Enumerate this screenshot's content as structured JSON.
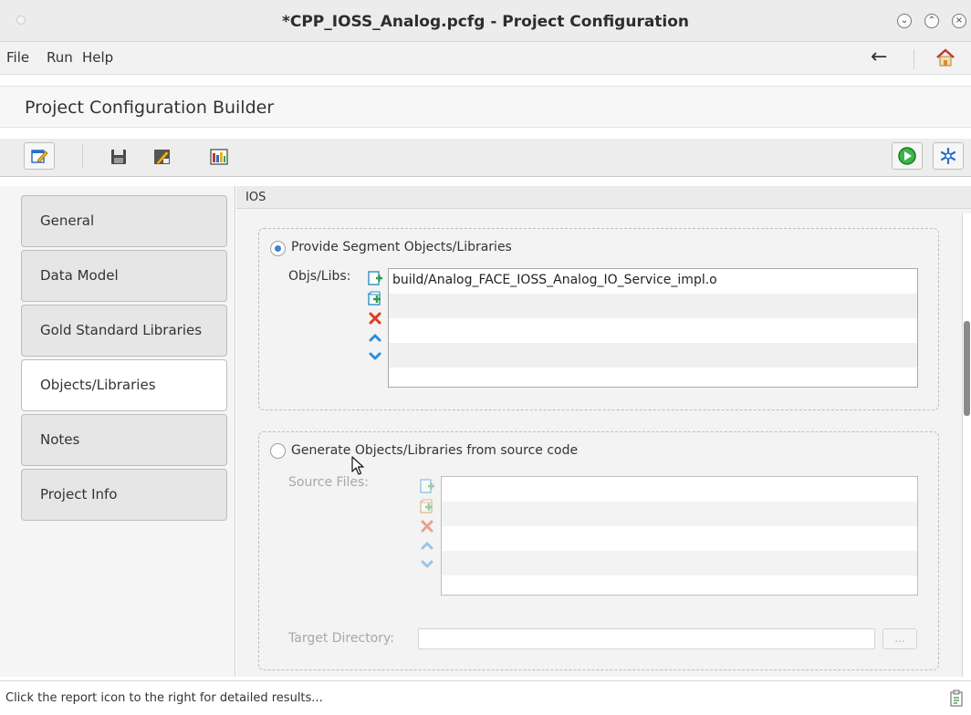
{
  "window": {
    "title": "*CPP_IOSS_Analog.pcfg - Project Configuration",
    "controls": [
      "minimize",
      "maximize",
      "close"
    ]
  },
  "menubar": {
    "items": [
      "File",
      "Run",
      "Help"
    ],
    "right_icons": [
      "back-arrow-icon",
      "home-icon"
    ]
  },
  "builder": {
    "title": "Project Configuration Builder"
  },
  "toolbar": {
    "left_icons": [
      "edit-config-icon",
      "save-icon",
      "build-tools-icon",
      "report-chart-icon"
    ],
    "right_icons": [
      "run-icon",
      "settings-snowflake-icon"
    ]
  },
  "nav": {
    "tabs": [
      {
        "label": "General",
        "active": false
      },
      {
        "label": "Data Model",
        "active": false
      },
      {
        "label": "Gold Standard Libraries",
        "active": false
      },
      {
        "label": "Objects/Libraries",
        "active": true
      },
      {
        "label": "Notes",
        "active": false
      },
      {
        "label": "Project Info",
        "active": false
      }
    ]
  },
  "section": {
    "header": "IOS",
    "provide": {
      "radio_label": "Provide Segment Objects/Libraries",
      "selected": true,
      "field_label": "Objs/Libs:",
      "items": [
        "build/Analog_FACE_IOSS_Analog_IO_Service_impl.o",
        "",
        "",
        "",
        ""
      ]
    },
    "generate": {
      "radio_label": "Generate Objects/Libraries from source code",
      "selected": false,
      "source_label": "Source Files:",
      "source_items": [
        "",
        "",
        "",
        "",
        ""
      ],
      "target_label": "Target Directory:",
      "target_value": "",
      "browse_label": "..."
    }
  },
  "status": {
    "text": "Click the report icon to the right for detailed results..."
  }
}
